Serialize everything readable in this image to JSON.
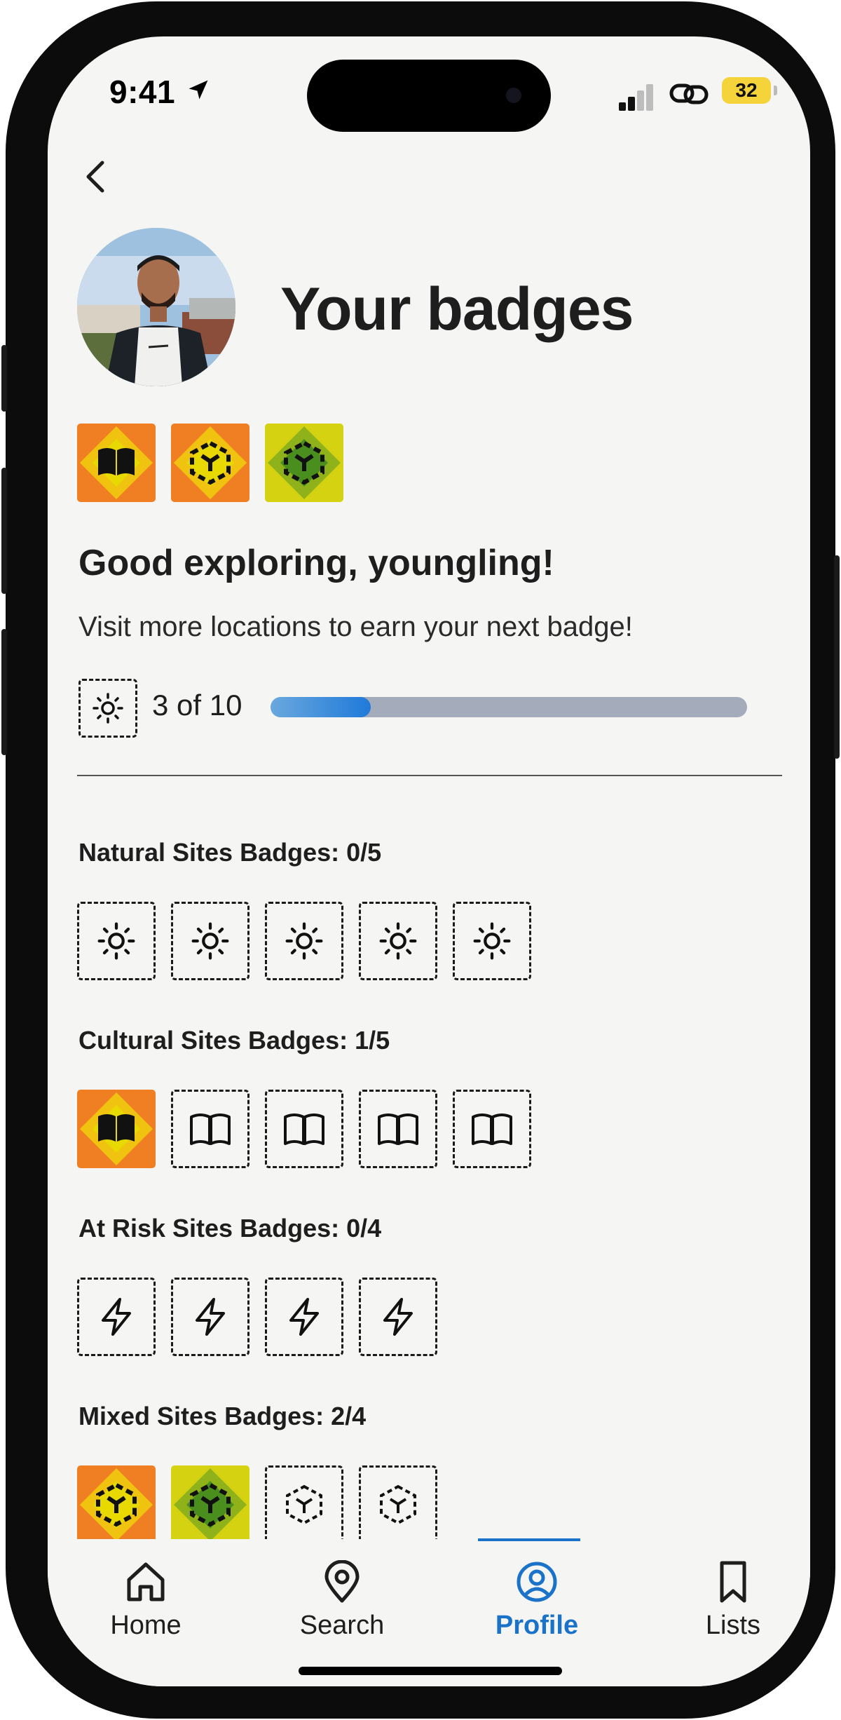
{
  "status_bar": {
    "time": "9:41",
    "battery": "32"
  },
  "header": {
    "title": "Your badges"
  },
  "summary": {
    "heading": "Good exploring, youngling!",
    "subtitle": "Visit more locations to earn your next badge!",
    "progress_text": "3 of 10",
    "progress_fraction": 0.21
  },
  "earned_badges": [
    "book-badge-earned",
    "cube-badge-earned-orange",
    "cube-badge-earned-green"
  ],
  "categories": [
    {
      "label": "Natural Sites Badges:  0/5",
      "icon": "sun-icon",
      "earned": 0,
      "total": 5
    },
    {
      "label": "Cultural Sites Badges:  1/5",
      "icon": "book-icon",
      "earned": 1,
      "total": 5
    },
    {
      "label": "At Risk Sites Badges:  0/4",
      "icon": "lightning-icon",
      "earned": 0,
      "total": 4
    },
    {
      "label": "Mixed Sites Badges:  2/4",
      "icon": "cube-icon",
      "earned": 2,
      "total": 4
    }
  ],
  "tabs": [
    {
      "label": "Home",
      "icon": "home-icon",
      "active": false
    },
    {
      "label": "Search",
      "icon": "location-pin-icon",
      "active": false
    },
    {
      "label": "Profile",
      "icon": "profile-icon",
      "active": true
    },
    {
      "label": "Lists",
      "icon": "bookmark-icon",
      "active": false
    }
  ],
  "colors": {
    "accent": "#1a73c9",
    "badge_orange": "#f07f23",
    "badge_yellow": "#e8d900",
    "badge_lime": "#d4d211",
    "progress_track": "#a4acbb"
  }
}
